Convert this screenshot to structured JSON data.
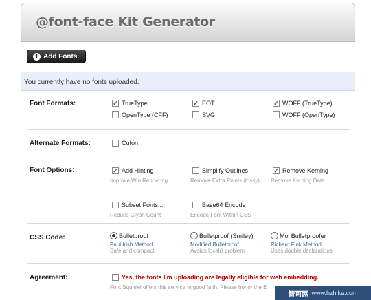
{
  "header": {
    "title": "@font-face Kit Generator"
  },
  "toolbar": {
    "add_fonts_label": "Add Fonts",
    "add_icon": "plus-circle-icon"
  },
  "notice": {
    "text": "You currently have no fonts uploaded."
  },
  "font_formats": {
    "label": "Font Formats:",
    "options": [
      {
        "label": "TrueType",
        "checked": true
      },
      {
        "label": "EOT",
        "checked": true
      },
      {
        "label": "WOFF (TrueType)",
        "checked": true
      },
      {
        "label": "OpenType (CFF)",
        "checked": false
      },
      {
        "label": "SVG",
        "checked": false
      },
      {
        "label": "WOFF (OpenType)",
        "checked": false
      }
    ]
  },
  "alternate_formats": {
    "label": "Alternate Formats:",
    "options": [
      {
        "label": "Cufón",
        "checked": false
      }
    ]
  },
  "font_options": {
    "label": "Font Options:",
    "options": [
      {
        "label": "Add Hinting",
        "desc": "Improve Win Rendering",
        "checked": true
      },
      {
        "label": "Simplify Outlines",
        "desc": "Remove Extra Points (lossy)",
        "checked": false
      },
      {
        "label": "Remove Kerning",
        "desc": "Remove Kerning Data",
        "checked": true
      },
      {
        "label": "Subset Fonts...",
        "desc": "Reduce Glyph Count",
        "checked": false
      },
      {
        "label": "Base64 Encode",
        "desc": "Encode Font Within CSS",
        "checked": false
      }
    ]
  },
  "css_code": {
    "label": "CSS Code:",
    "options": [
      {
        "label": "Bulletproof",
        "link": "Paul Irish Method",
        "desc": "Safe and compact",
        "selected": true
      },
      {
        "label": "Bulletproof (Smiley)",
        "link": "Modified Bulletproof",
        "desc": "Avoids local() problem",
        "selected": false
      },
      {
        "label": "Mo' Bulletproofer",
        "link": "Richard Fink Method",
        "desc": "Uses double declarations",
        "selected": false
      }
    ]
  },
  "agreement": {
    "label": "Agreement:",
    "text": "Yes, the fonts I'm uploading are legally eligible for web embedding.",
    "desc": "Font Squirrel offers this service in good faith. Please honor the E",
    "checked": false
  },
  "watermark": {
    "site": "智可网",
    "url": "www.hzhike.com"
  },
  "colors": {
    "accent_link": "#2e6aa6",
    "agreement_text": "#cc0000",
    "notice_bg": "#e9eff8",
    "check_mark": "#1c7a1c"
  }
}
